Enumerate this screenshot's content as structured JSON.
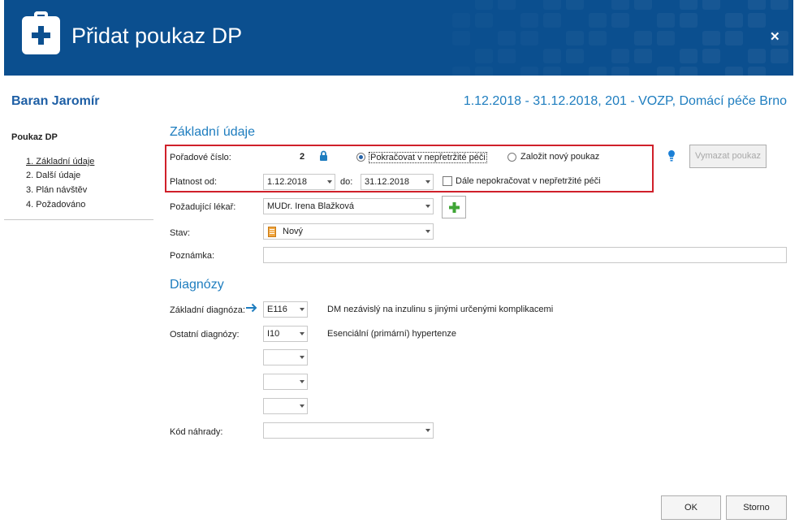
{
  "dialog": {
    "title": "Přidat poukaz DP",
    "close_glyph": "✕"
  },
  "patient": {
    "name": "Baran Jaromír",
    "period": "1.12.2018 - 31.12.2018, 201 - VOZP, Domácí péče Brno"
  },
  "sidebar": {
    "title": "Poukaz DP",
    "items": [
      {
        "label": "1. Základní údaje",
        "active": true
      },
      {
        "label": "2. Další údaje"
      },
      {
        "label": "3. Plán návštěv"
      },
      {
        "label": "4. Požadováno"
      }
    ]
  },
  "basic": {
    "section_title": "Základní údaje",
    "order_label": "Pořadové číslo:",
    "order_value": "2",
    "radio_continue": "Pokračovat v nepřetržité péči",
    "radio_new": "Založit nový poukaz",
    "delete_button": "Vymazat poukaz",
    "valid_from_label": "Platnost od:",
    "valid_from": "1.12.2018",
    "to_label": "do:",
    "valid_to": "31.12.2018",
    "no_continue_label": "Dále nepokračovat v nepřetržité péči",
    "doctor_label": "Požadující lékař:",
    "doctor": "MUDr. Irena Blažková",
    "status_label": "Stav:",
    "status": "Nový",
    "note_label": "Poznámka:",
    "note": ""
  },
  "diagnoses": {
    "section_title": "Diagnózy",
    "main_label": "Základní diagnóza:",
    "main_code": "E116",
    "main_desc": "DM nezávislý na inzulinu s jinými určenými komplikacemi",
    "other_label": "Ostatní diagnózy:",
    "other_codes": [
      "I10",
      "",
      "",
      ""
    ],
    "other_desc": "Esenciální (primární) hypertenze",
    "replacement_label": "Kód náhrady:",
    "replacement": ""
  },
  "buttons": {
    "ok": "OK",
    "cancel": "Storno"
  },
  "colors": {
    "header": "#0b4f8f",
    "accent": "#1e7dbf",
    "highlight": "#d0202a",
    "add_icon": "#3fa535",
    "hint": "#1a7fd6"
  },
  "icons": [
    "medical-kit-icon",
    "close-icon",
    "lock-icon",
    "lightbulb-icon",
    "plus-icon",
    "status-document-icon",
    "arrow-right-icon",
    "chevron-down-icon"
  ]
}
